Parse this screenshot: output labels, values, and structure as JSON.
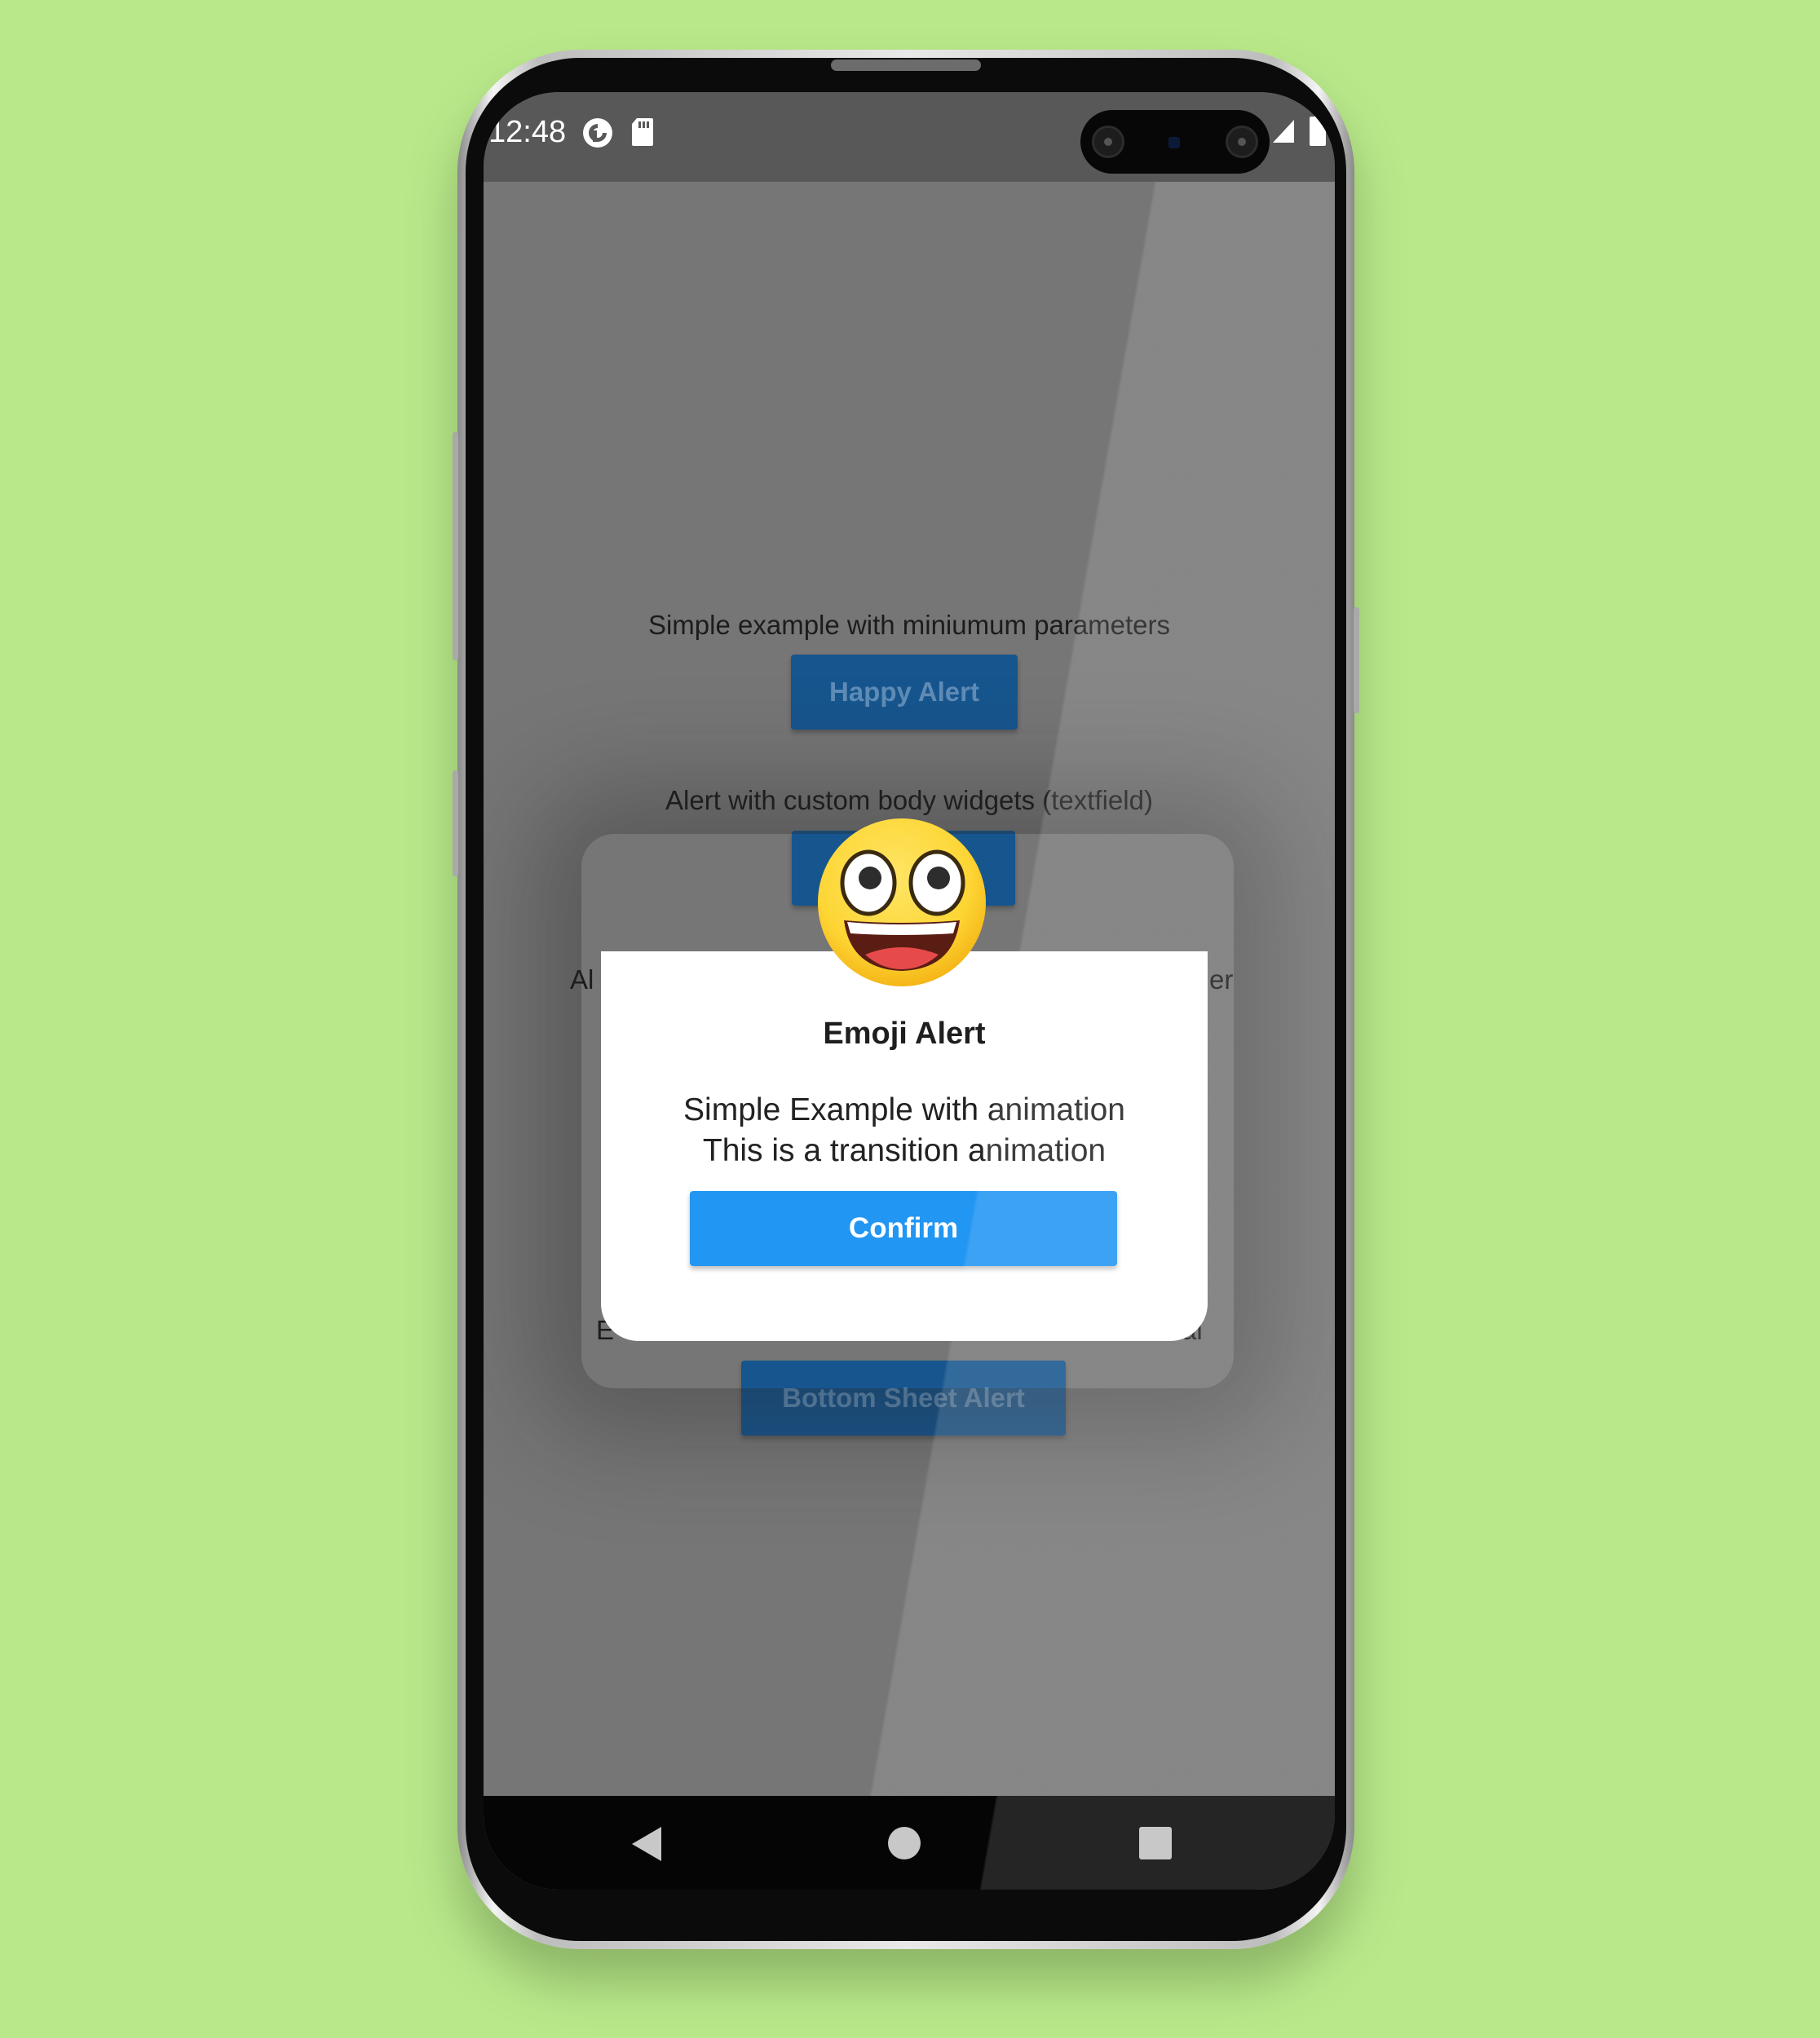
{
  "status_bar": {
    "time": "12:48",
    "icons": [
      "pocket-casts-icon",
      "sd-card-icon",
      "cell-signal-icon",
      "battery-icon"
    ]
  },
  "main": {
    "sections": [
      {
        "label": "Simple example with miniumum parameters",
        "button": "Happy Alert"
      },
      {
        "label": "Alert with custom body widgets (textfield)"
      },
      {
        "label_left": "Al",
        "label_right": "er"
      },
      {
        "label_left": "E",
        "label_right": "al",
        "button": "Bottom Sheet Alert"
      }
    ]
  },
  "dialog": {
    "emoji": "grinning-face-emoji",
    "title": "Emoji Alert",
    "body_line1": "Simple Example with animation",
    "body_line2": "This is a transition animation",
    "confirm_label": "Confirm"
  },
  "nav_bar": {
    "buttons": [
      "back-icon",
      "home-icon",
      "recents-icon"
    ]
  },
  "colors": {
    "background": "#b9e88a",
    "dialog_button": "#2196f3",
    "dimmed_button": "#17558e",
    "overlay": "#767676"
  }
}
